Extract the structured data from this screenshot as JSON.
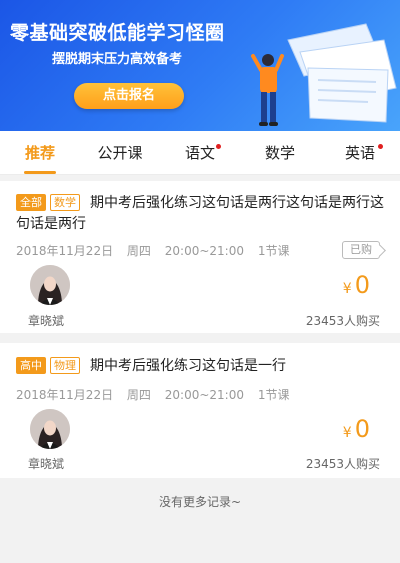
{
  "banner": {
    "headline": "零基础突破低能学习怪圈",
    "subline": "摆脱期末压力高效备考",
    "cta_label": "点击报名"
  },
  "tabs": [
    {
      "label": "推荐",
      "active": true,
      "dot": false
    },
    {
      "label": "公开课",
      "active": false,
      "dot": false
    },
    {
      "label": "语文",
      "active": false,
      "dot": true
    },
    {
      "label": "数学",
      "active": false,
      "dot": false
    },
    {
      "label": "英语",
      "active": false,
      "dot": true
    }
  ],
  "courses": [
    {
      "tag_level": "全部",
      "tag_subject": "数学",
      "title": "期中考后强化练习这句话是两行这句话是两行这句话是两行",
      "date": "2018年11月22日",
      "weekday": "周四",
      "time": "20:00~21:00",
      "lessons": "1节课",
      "bought_label": "已购",
      "teacher": "章晓斌",
      "currency": "¥",
      "price": "0",
      "buyers": "23453人购买"
    },
    {
      "tag_level": "高中",
      "tag_subject": "物理",
      "title": "期中考后强化练习这句话是一行",
      "date": "2018年11月22日",
      "weekday": "周四",
      "time": "20:00~21:00",
      "lessons": "1节课",
      "teacher": "章晓斌",
      "currency": "¥",
      "price": "0",
      "buyers": "23453人购买"
    }
  ],
  "footer": {
    "no_more": "没有更多记录~"
  },
  "colors": {
    "accent": "#f39a1b",
    "banner_blue": "#2f7cf5",
    "dot_red": "#e02020"
  }
}
